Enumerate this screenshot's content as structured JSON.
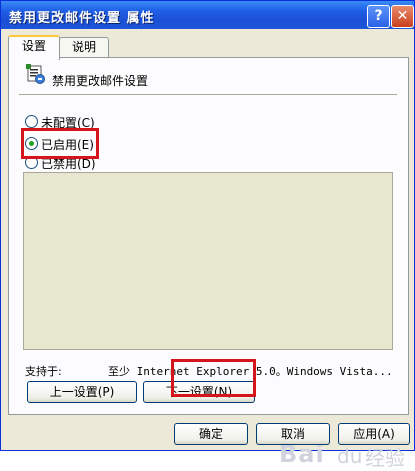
{
  "window": {
    "title": "禁用更改邮件设置 属性",
    "help_glyph": "?",
    "close_glyph": "✕"
  },
  "tabs": [
    {
      "label": "设置",
      "active": true
    },
    {
      "label": "说明",
      "active": false
    }
  ],
  "policy": {
    "title": "禁用更改邮件设置",
    "icon": "policy-setting-icon"
  },
  "radios": [
    {
      "label": "未配置(C)",
      "checked": false
    },
    {
      "label": "已启用(E)",
      "checked": true
    },
    {
      "label": "已禁用(D)",
      "checked": false
    }
  ],
  "supported": {
    "label": "支持于:",
    "value": "至少 Internet Explorer 5.0。Windows Vista..."
  },
  "buttons": {
    "prev": "上一设置(P)",
    "next": "下一设置(N)",
    "ok": "确定",
    "cancel": "取消",
    "apply": "应用(A)"
  },
  "watermark": {
    "brand": "Bai",
    "paw": "du",
    "cn": "经验"
  },
  "colors": {
    "titlebar": "#1f5fe6",
    "dialog_bg": "#ece9d8",
    "highlight": "#d6141b",
    "radio_checked": "#21a121"
  }
}
